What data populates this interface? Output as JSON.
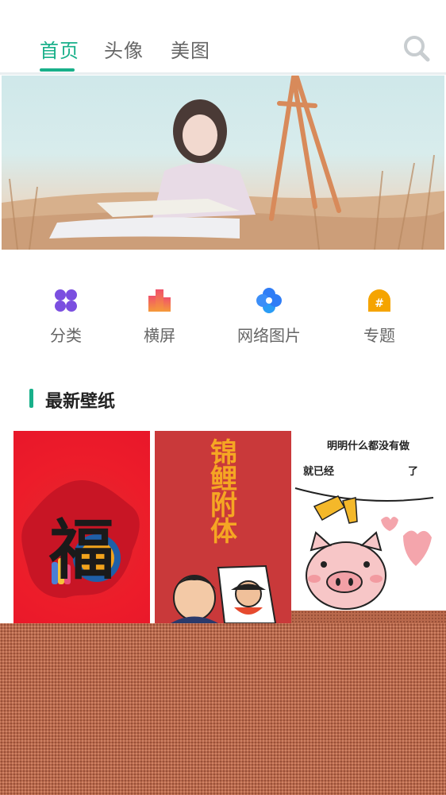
{
  "nav": {
    "tabs": [
      {
        "label": "首页",
        "active": true
      },
      {
        "label": "头像",
        "active": false
      },
      {
        "label": "美图",
        "active": false
      }
    ],
    "search_icon": "search-icon",
    "accent_color": "#19b08a"
  },
  "categories": [
    {
      "label": "分类",
      "icon": "grid-dots-icon",
      "color": "#7b4fe0"
    },
    {
      "label": "横屏",
      "icon": "bar-chart-icon",
      "color": "#f26b3a"
    },
    {
      "label": "网络图片",
      "icon": "flower-icon",
      "color": "#2f7df6"
    },
    {
      "label": "专题",
      "icon": "hashtag-icon",
      "color": "#f5a400"
    }
  ],
  "section": {
    "title": "最新壁纸"
  },
  "wallpapers": [
    {
      "label": "福"
    },
    {
      "text": "锦鲤附体"
    },
    {
      "line1": "明明什么都没有做",
      "line2": "就已经",
      "line3": "了"
    }
  ]
}
